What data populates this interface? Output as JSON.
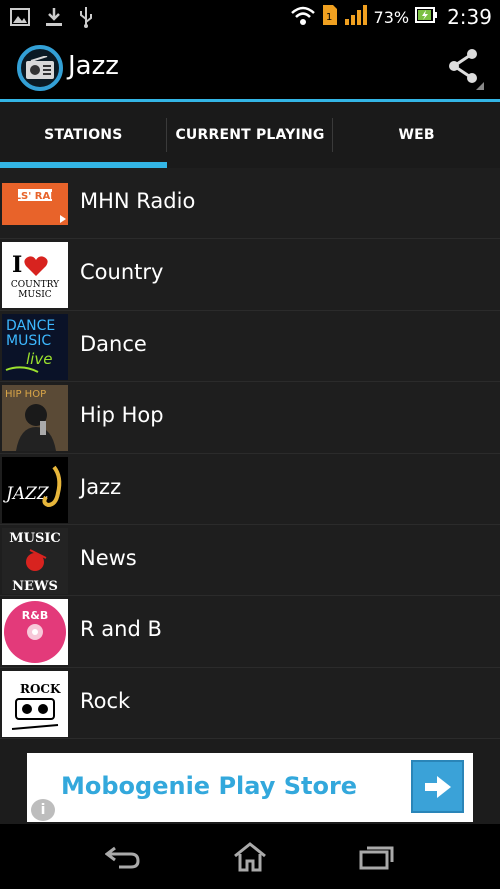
{
  "status_bar": {
    "battery_percent": "73%",
    "time": "2:39"
  },
  "app": {
    "title": "Jazz"
  },
  "tabs": [
    {
      "label": "STATIONS",
      "selected": true
    },
    {
      "label": "CURRENT PLAYING",
      "selected": false
    },
    {
      "label": "WEB",
      "selected": false
    }
  ],
  "stations": [
    {
      "label": "MHN Radio",
      "thumb_text": "PULS' RADIO"
    },
    {
      "label": "Country",
      "thumb_text": "I COUNTRY MUSIC"
    },
    {
      "label": "Dance",
      "thumb_text": "DANCE MUSIC live"
    },
    {
      "label": "Hip Hop",
      "thumb_text": "HIP HOP"
    },
    {
      "label": "Jazz",
      "thumb_text": "JAZZ"
    },
    {
      "label": "News",
      "thumb_text": "MUSIC NEWS"
    },
    {
      "label": "R and B",
      "thumb_text": "R&B"
    },
    {
      "label": "Rock",
      "thumb_text": "ROCK"
    }
  ],
  "ad": {
    "text": "Mobogenie Play Store",
    "info": "i"
  },
  "colors": {
    "accent": "#33b5e5",
    "ad_text": "#33a8dc"
  }
}
